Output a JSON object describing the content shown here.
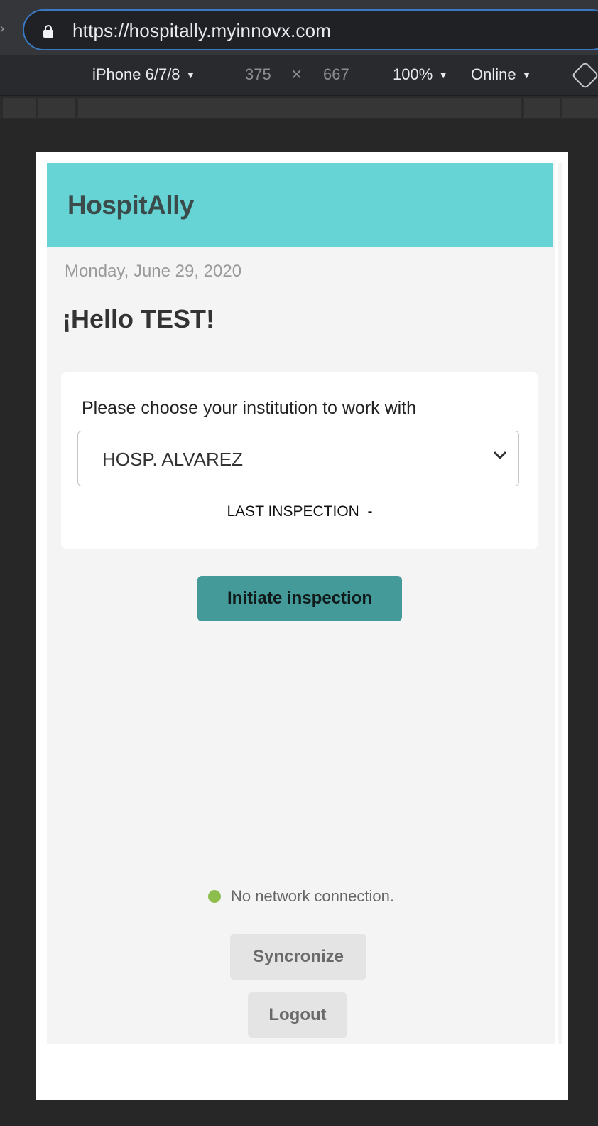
{
  "browser": {
    "url": "https://hospitally.myinnovx.com"
  },
  "devtools": {
    "device": "iPhone 6/7/8",
    "width": "375",
    "times": "×",
    "height": "667",
    "zoom": "100%",
    "network": "Online"
  },
  "app": {
    "title": "HospitAlly",
    "date": "Monday, June 29, 2020",
    "greeting": "¡Hello TEST!",
    "card": {
      "prompt": "Please choose your institution to work with",
      "selected_institution": "HOSP. ALVAREZ",
      "last_inspection_label": "LAST INSPECTION",
      "last_inspection_value": "-"
    },
    "initiate_button": "Initiate inspection",
    "network_status": "No network connection.",
    "sync_button": "Syncronize",
    "logout_button": "Logout"
  },
  "colors": {
    "header": "#66d4d4",
    "primary_button": "#449a98",
    "status_dot": "#8dbd4d"
  }
}
